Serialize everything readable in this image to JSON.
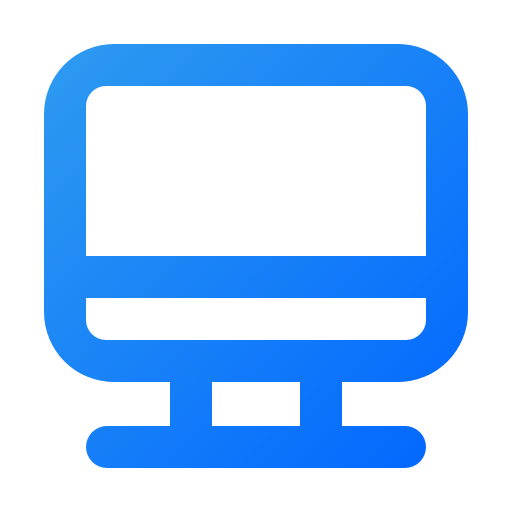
{
  "icon": {
    "name": "desktop-computer-icon",
    "colors": {
      "gradient_start": "#2E9BF0",
      "gradient_end": "#0066FF",
      "background": "#FFFFFF"
    }
  }
}
